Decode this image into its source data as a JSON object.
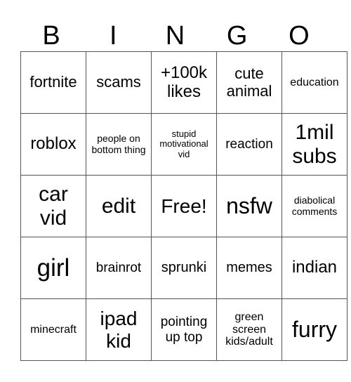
{
  "header": {
    "letters": [
      "B",
      "I",
      "N",
      "G",
      "O"
    ]
  },
  "grid": {
    "rows": [
      [
        "fortnite",
        "scams",
        "+100k likes",
        "cute animal",
        "education"
      ],
      [
        "roblox",
        "people on bottom thing",
        "stupid motivational vid",
        "reaction",
        "1mil subs"
      ],
      [
        "car vid",
        "edit",
        "Free!",
        "nsfw",
        "diabolical comments"
      ],
      [
        "girl",
        "brainrot",
        "sprunki",
        "memes",
        "indian"
      ],
      [
        "minecraft",
        "ipad kid",
        "pointing up top",
        "green screen kids/adult",
        "furry"
      ]
    ]
  }
}
